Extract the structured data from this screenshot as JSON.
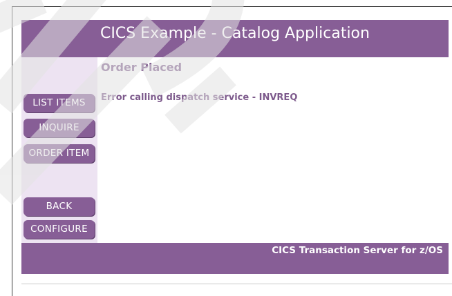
{
  "header": {
    "title": "CICS Example - Catalog Application"
  },
  "main": {
    "title": "Order Placed",
    "message": "Error calling dispatch service - INVREQ"
  },
  "sidebar": {
    "items": [
      {
        "label": "LIST ITEMS"
      },
      {
        "label": "INQUIRE"
      },
      {
        "label": "ORDER ITEM"
      },
      {
        "label": "BACK"
      },
      {
        "label": "CONFIGURE"
      }
    ]
  },
  "footer": {
    "text": "CICS Transaction Server for z/OS"
  },
  "colors": {
    "brand_purple": "#875e96",
    "sidebar_bg": "#ede3f2",
    "text_purple": "#7d5a8c",
    "watermark": "#e3e3e3"
  }
}
